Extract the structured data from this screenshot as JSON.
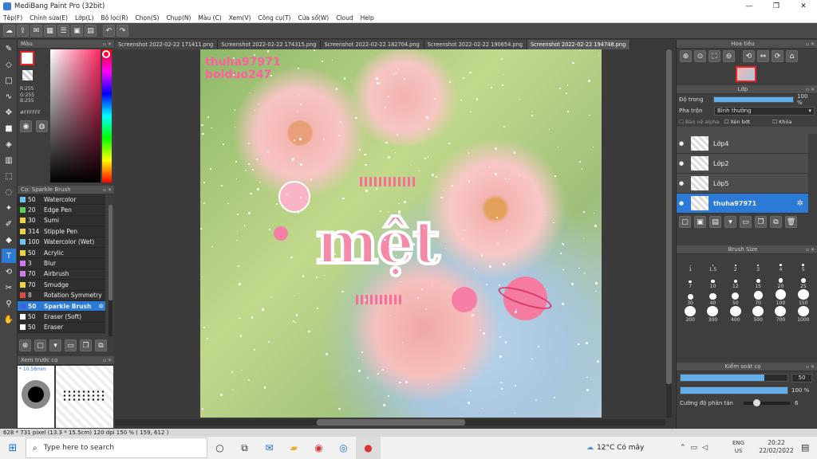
{
  "window": {
    "title": "MediBang Paint Pro (32bit)",
    "minimize": "—",
    "maximize": "❐",
    "close": "✕"
  },
  "menu": [
    "Tệp(F)",
    "Chỉnh sửa(E)",
    "Lớp(L)",
    "Bộ lọc(R)",
    "Chọn(S)",
    "Chụp(N)",
    "Màu (C)",
    "Xem(V)",
    "Công cụ(T)",
    "Cửa sổ(W)",
    "Cloud",
    "Help"
  ],
  "color_panel": {
    "title": "Màu",
    "r": "R:255",
    "g": "G:255",
    "b": "B:255",
    "hex": "#FFFFFF"
  },
  "brush_panel": {
    "title": "Cọ: Sparkle Brush",
    "items": [
      {
        "size": "50",
        "name": "Watercolor",
        "color": "#6ec3f0"
      },
      {
        "size": "20",
        "name": "Edge Pen",
        "color": "#5bd15b"
      },
      {
        "size": "30",
        "name": "Sumi",
        "color": "#f0d243"
      },
      {
        "size": "314",
        "name": "Stipple Pen",
        "color": "#f0d243"
      },
      {
        "size": "100",
        "name": "Watercolor (Wet)",
        "color": "#6ec3f0"
      },
      {
        "size": "50",
        "name": "Acrylic",
        "color": "#f0d243"
      },
      {
        "size": "3",
        "name": "Blur",
        "color": "#d07af0"
      },
      {
        "size": "70",
        "name": "Airbrush",
        "color": "#d07af0"
      },
      {
        "size": "70",
        "name": "Smudge",
        "color": "#f0d243"
      },
      {
        "size": "8",
        "name": "Rotation Symmetry",
        "color": "#e04a4a"
      },
      {
        "size": "50",
        "name": "Sparkle Brush",
        "color": "#3a66e0",
        "selected": true
      },
      {
        "size": "50",
        "name": "Eraser (Soft)",
        "color": "#ffffff"
      },
      {
        "size": "50",
        "name": "Eraser",
        "color": "#ffffff"
      }
    ]
  },
  "preview_panel": {
    "title": "Xem trước cọ",
    "size_label": "* 10.58mm"
  },
  "tabs": [
    "Screenshot 2022-02-22 171411.png",
    "Screenshot 2022-02-22 174315.png",
    "Screenshot 2022-02-22 182704.png",
    "Screenshot 2022-02-22 190654.png",
    "Screenshot 2022-02-22 194748.png"
  ],
  "canvas": {
    "watermark_line1": "thuha97971",
    "watermark_line2": "bolduo247",
    "main_text": "mệt"
  },
  "navigator": {
    "title": "Hoa tiêu"
  },
  "layer_panel": {
    "title": "Lớp",
    "opacity_label": "Độ trong",
    "opacity_value": "100 %",
    "opacity": 1.0,
    "blend_label": "Pha trộn",
    "blend_value": "Bình thường",
    "protect_alpha": "Bảo vệ alpha",
    "clipping": "Xén bớt",
    "lock": "Khóa",
    "layers": [
      {
        "name": "Lớp4",
        "selected": false
      },
      {
        "name": "Lớp2",
        "selected": false
      },
      {
        "name": "Lớp5",
        "selected": false
      },
      {
        "name": "thuha97971",
        "selected": true
      }
    ]
  },
  "brush_size_panel": {
    "title": "Brush Size",
    "sizes": [
      "1",
      "1.5",
      "2",
      "3",
      "4",
      "5",
      "7",
      "10",
      "12",
      "15",
      "20",
      "25",
      "30",
      "40",
      "50",
      "70",
      "100",
      "150",
      "200",
      "300",
      "400",
      "500",
      "700",
      "1000"
    ]
  },
  "brush_control": {
    "title": "Kiểm soát cọ",
    "size_value": "50",
    "size_fraction": 0.78,
    "opacity_value": "100 %",
    "opacity_fraction": 1.0,
    "scatter_label": "Cường độ phân tán",
    "scatter_value": "6",
    "scatter_fraction": 0.2
  },
  "status": {
    "text": "628 * 731 pixel   (13.3 * 15.5cm)   120 dpi   150 %   ( 159, 612 )"
  },
  "taskbar": {
    "search_placeholder": "Type here to search",
    "weather": "12°C  Có mây",
    "lang_line1": "ENG",
    "lang_line2": "US",
    "time": "20:22",
    "date": "22/02/2022"
  }
}
